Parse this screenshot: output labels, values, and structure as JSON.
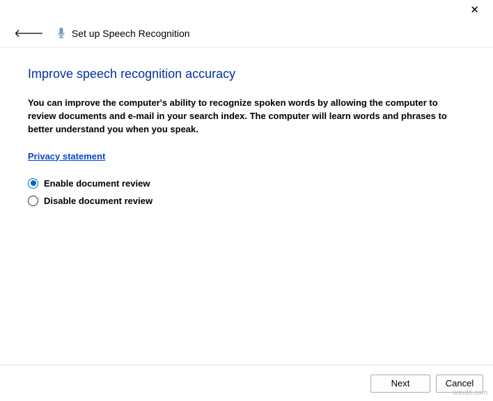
{
  "header": {
    "wizard_title": "Set up Speech Recognition"
  },
  "content": {
    "heading": "Improve speech recognition accuracy",
    "body": "You can improve the computer's ability to recognize spoken words by allowing the computer to review documents and e-mail in your search index. The computer will learn words and phrases to better understand you when you speak.",
    "privacy_link": "Privacy statement"
  },
  "options": {
    "enable_label": "Enable document review",
    "disable_label": "Disable document review",
    "selected": "enable"
  },
  "footer": {
    "next_label": "Next",
    "cancel_label": "Cancel"
  },
  "watermark": "wsxdn.com"
}
